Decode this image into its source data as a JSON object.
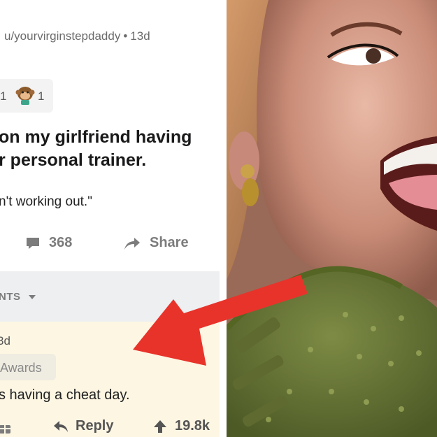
{
  "post": {
    "username": "u/yourvirginstepdaddy",
    "separator": "•",
    "age": "13d",
    "award_count_1": "1",
    "award_count_2": "1",
    "title_line1": "on my girlfriend having",
    "title_line2": "r personal trainer.",
    "body": "n't working out.\"",
    "comments_count": "368",
    "share_label": "Share"
  },
  "sort_label": "NTS",
  "comment": {
    "age": "3d",
    "awards_label": "Awards",
    "text": "s having a cheat day.",
    "reply_label": "Reply",
    "votes": "19.8k"
  },
  "colors": {
    "arrow": "#e8332a",
    "comment_bg": "#fdf6e3",
    "separator_bg": "#edeff1",
    "dress": "#6b7a3a"
  }
}
